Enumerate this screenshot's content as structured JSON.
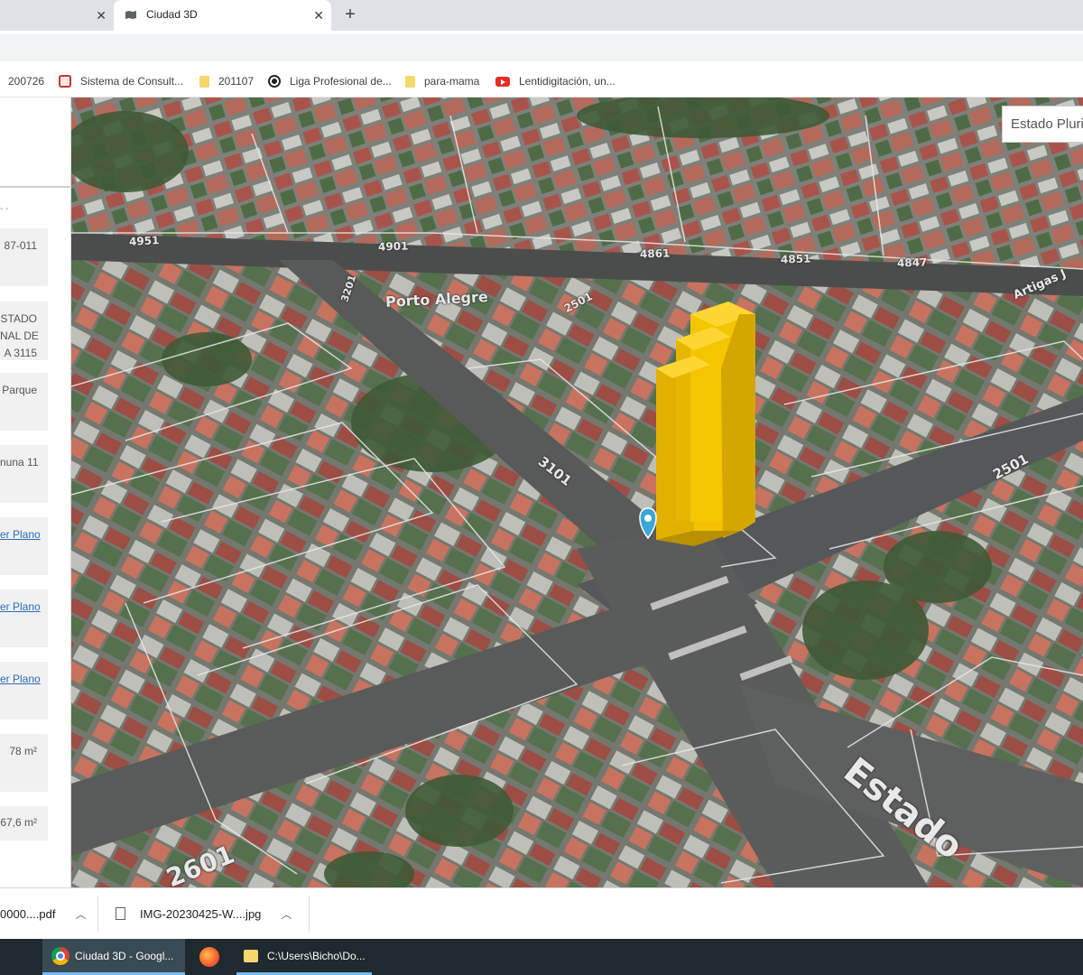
{
  "tabs": [
    {
      "label": ""
    },
    {
      "label": "Ciudad 3D"
    }
  ],
  "bookmarks": [
    {
      "label": "200726",
      "icon": "none"
    },
    {
      "label": "Sistema de Consult...",
      "icon": "search-icon"
    },
    {
      "label": "201107",
      "icon": "folder-icon"
    },
    {
      "label": "Liga Profesional de...",
      "icon": "football-icon"
    },
    {
      "label": "para-mama",
      "icon": "folder-icon"
    },
    {
      "label": "Lentidigitación, un...",
      "icon": "youtube-icon"
    }
  ],
  "sidebar": {
    "small": "- -",
    "cards": [
      {
        "lines": [
          "87-011"
        ]
      },
      {
        "lines": [
          "STADO",
          "NAL DE",
          "A 3115"
        ]
      },
      {
        "lines": [
          "Parque"
        ]
      },
      {
        "lines": [
          "nuna 11"
        ]
      },
      {
        "link": "er Plano"
      },
      {
        "link": "er Plano"
      },
      {
        "link": "er Plano"
      },
      {
        "lines": [
          "78 m²"
        ]
      },
      {
        "lines": [
          "67,6 m²"
        ]
      }
    ]
  },
  "map": {
    "search_placeholder": "Estado Plurinacional de Bolivia",
    "labels": [
      "4951",
      "4901",
      "4861",
      "4851",
      "4847",
      "Porto Alegre",
      "2501",
      "3101",
      "2501",
      "2601",
      "Estado",
      "3201",
      "Artigas J"
    ],
    "colors": {
      "building": "#f2c200",
      "pin": "#3aa7d6",
      "parcel": "#e8e8e8"
    }
  },
  "downloads": [
    {
      "label": "0000....pdf"
    },
    {
      "label": "IMG-20230425-W....jpg"
    }
  ],
  "taskbar": [
    {
      "label": "Ciudad 3D - Googl..."
    },
    {
      "label": ""
    },
    {
      "label": "C:\\Users\\Bicho\\Do..."
    }
  ]
}
